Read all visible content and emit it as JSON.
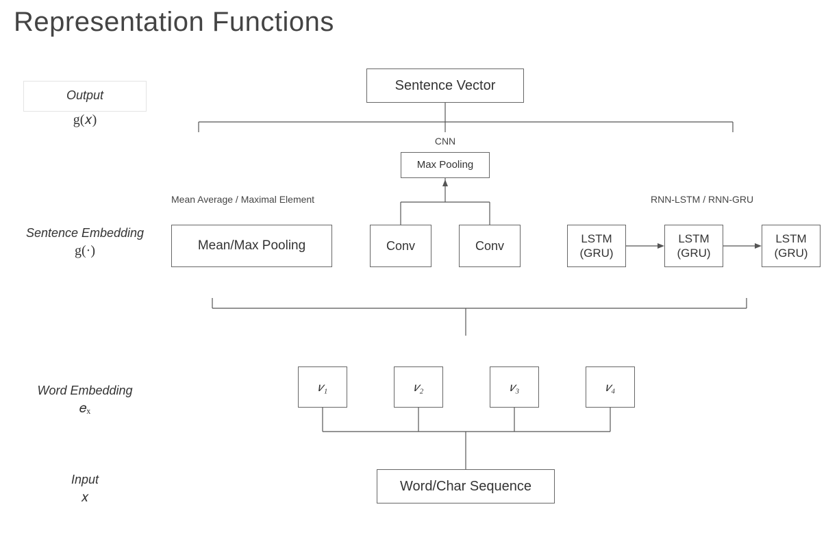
{
  "title": "Representation Functions",
  "left": {
    "output_label": "Output",
    "output_math": "g(𝑥)",
    "sentemb_label": "Sentence Embedding",
    "sentemb_math": "g(·)",
    "wordemb_label": "Word Embedding",
    "wordemb_math": "𝑒ₓ",
    "input_label": "Input",
    "input_math": "𝑥"
  },
  "diagram": {
    "sentence_vector": "Sentence Vector",
    "cnn_label": "CNN",
    "maxpool": "Max Pooling",
    "meanmax_label": "Mean Average  / Maximal Element",
    "rnn_label": "RNN-LSTM  / RNN-GRU",
    "meanmax_box": "Mean/Max  Pooling",
    "conv1": "Conv",
    "conv2": "Conv",
    "lstm1": "LSTM\n(GRU)",
    "lstm2": "LSTM\n(GRU)",
    "lstm3": "LSTM\n(GRU)",
    "v1": "𝑣₁",
    "v2": "𝑣₂",
    "v3": "𝑣₃",
    "v4": "𝑣₄",
    "wordchar": "Word/Char Sequence"
  }
}
